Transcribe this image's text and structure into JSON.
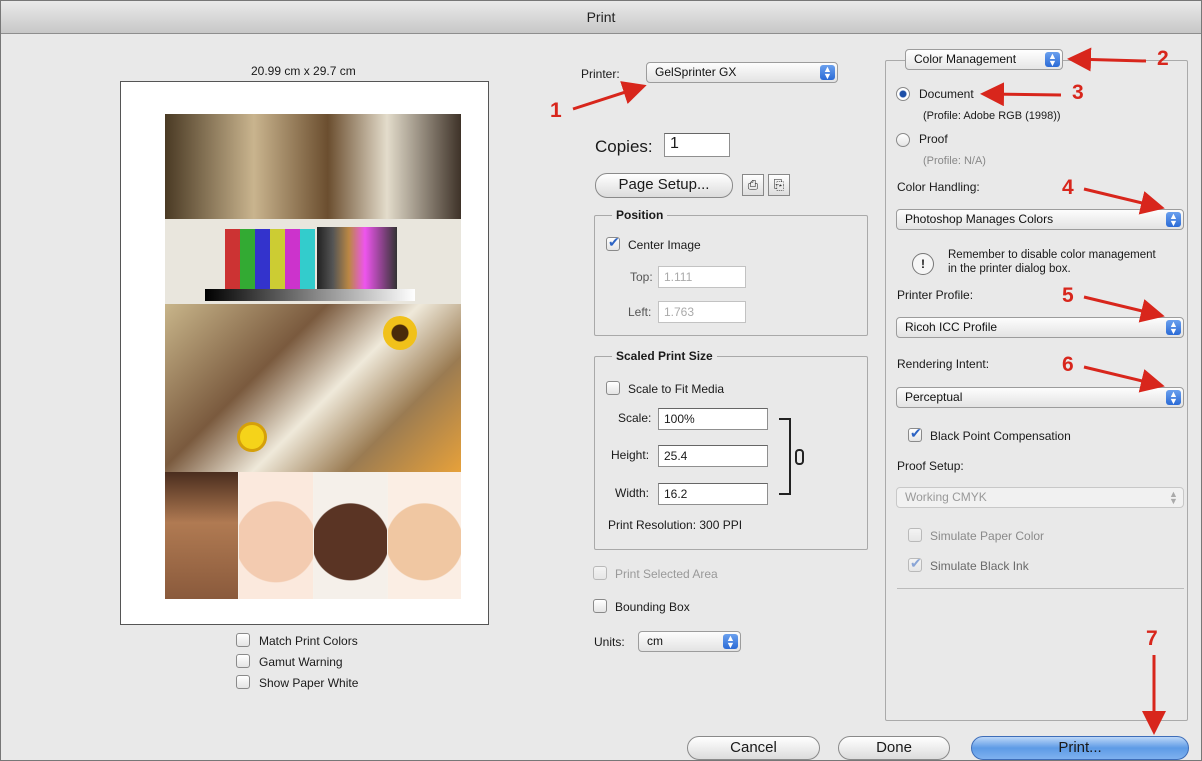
{
  "window": {
    "title": "Print"
  },
  "preview": {
    "page_size": "20.99 cm x 29.7 cm"
  },
  "preview_checks": [
    {
      "label": "Match Print Colors",
      "checked": false
    },
    {
      "label": "Gamut Warning",
      "checked": false
    },
    {
      "label": "Show Paper White",
      "checked": false
    }
  ],
  "printer": {
    "label": "Printer:",
    "value": "GelSprinter GX"
  },
  "copies": {
    "label": "Copies:",
    "value": "1"
  },
  "page_setup": {
    "label": "Page Setup..."
  },
  "position": {
    "title": "Position",
    "center_label": "Center Image",
    "center_checked": true,
    "top_label": "Top:",
    "top_value": "1.111",
    "left_label": "Left:",
    "left_value": "1.763"
  },
  "scaled": {
    "title": "Scaled Print Size",
    "fit_label": "Scale to Fit Media",
    "fit_checked": false,
    "scale_label": "Scale:",
    "scale_value": "100%",
    "height_label": "Height:",
    "height_value": "25.4",
    "width_label": "Width:",
    "width_value": "16.2",
    "resolution": "Print Resolution: 300 PPI"
  },
  "print_selected": {
    "label": "Print Selected Area",
    "checked": false
  },
  "bounding_box": {
    "label": "Bounding Box",
    "checked": false
  },
  "units": {
    "label": "Units:",
    "value": "cm"
  },
  "color_mgmt": {
    "section": "Color Management",
    "doc_label": "Document",
    "doc_profile": "(Profile: Adobe RGB (1998))",
    "proof_label": "Proof",
    "proof_profile": "(Profile: N/A)",
    "handling_label": "Color Handling:",
    "handling_value": "Photoshop Manages Colors",
    "note_line1": "Remember to disable color management",
    "note_line2": "in the printer dialog box.",
    "printer_profile_label": "Printer Profile:",
    "printer_profile_value": "Ricoh ICC Profile",
    "intent_label": "Rendering Intent:",
    "intent_value": "Perceptual",
    "bpc_label": "Black Point Compensation",
    "bpc_checked": true,
    "proof_setup_label": "Proof Setup:",
    "proof_setup_value": "Working CMYK",
    "sim_paper_label": "Simulate Paper Color",
    "sim_paper_checked": false,
    "sim_black_label": "Simulate Black Ink",
    "sim_black_checked": true
  },
  "buttons": {
    "cancel": "Cancel",
    "done": "Done",
    "print": "Print..."
  },
  "annotations": [
    "1",
    "2",
    "3",
    "4",
    "5",
    "6",
    "7"
  ],
  "colors": {
    "accent": "#2c6bd6",
    "annotation": "#d8261c"
  }
}
